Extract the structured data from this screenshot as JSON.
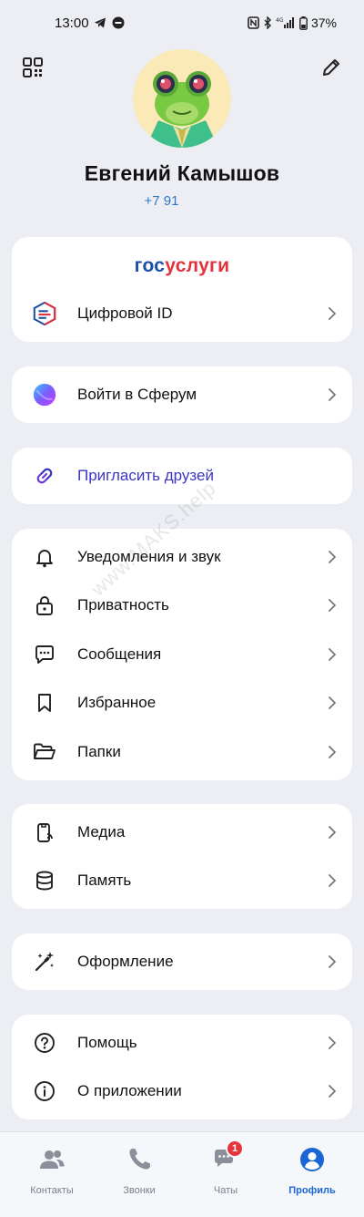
{
  "status": {
    "time": "13:00",
    "battery": "37%"
  },
  "profile": {
    "name": "Евгений Камышов",
    "phone": "+7 91"
  },
  "gosuslugi": {
    "logo_part1": "гос",
    "logo_part2": "услуги",
    "digital_id_label": "Цифровой ID"
  },
  "sferum": {
    "label": "Войти в Сферум"
  },
  "invite": {
    "label": "Пригласить друзей"
  },
  "settings": {
    "items": [
      {
        "label": "Уведомления и звук",
        "icon": "bell-icon"
      },
      {
        "label": "Приватность",
        "icon": "lock-icon"
      },
      {
        "label": "Сообщения",
        "icon": "chat-bubble-icon"
      },
      {
        "label": "Избранное",
        "icon": "bookmark-icon"
      },
      {
        "label": "Папки",
        "icon": "folder-icon"
      }
    ]
  },
  "storage": {
    "items": [
      {
        "label": "Медиа",
        "icon": "media-icon"
      },
      {
        "label": "Память",
        "icon": "database-icon"
      }
    ]
  },
  "appearance": {
    "label": "Оформление",
    "icon": "magic-wand-icon"
  },
  "support": {
    "items": [
      {
        "label": "Помощь",
        "icon": "help-icon"
      },
      {
        "label": "О приложении",
        "icon": "info-icon"
      }
    ]
  },
  "nav": {
    "items": [
      {
        "label": "Контакты",
        "icon": "contacts-icon"
      },
      {
        "label": "Звонки",
        "icon": "phone-icon"
      },
      {
        "label": "Чаты",
        "icon": "chats-icon",
        "badge": "1"
      },
      {
        "label": "Профиль",
        "icon": "profile-icon",
        "active": true
      }
    ]
  },
  "watermark": "www.MAKS.help",
  "colors": {
    "background": "#eceef3",
    "card": "#ffffff",
    "accent": "#1a66d6",
    "invite": "#3b36c4",
    "badge": "#e8333b"
  }
}
